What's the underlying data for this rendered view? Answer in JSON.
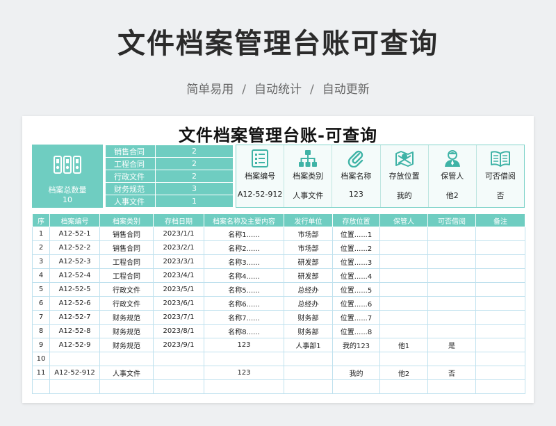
{
  "hero": {
    "title": "文件档案管理台账可查询",
    "features": [
      "简单易用",
      "自动统计",
      "自动更新"
    ],
    "separator": "/"
  },
  "sheet": {
    "title": "文件档案管理台账-可查询",
    "summary": {
      "total_label": "档案总数量",
      "total_value": "10",
      "categories": [
        {
          "name": "销售合同",
          "count": "2"
        },
        {
          "name": "工程合同",
          "count": "2"
        },
        {
          "name": "行政文件",
          "count": "2"
        },
        {
          "name": "财务规范",
          "count": "3"
        },
        {
          "name": "人事文件",
          "count": "1"
        }
      ]
    },
    "query": [
      {
        "icon": "list-number-icon",
        "label": "档案编号",
        "value": "A12-52-912"
      },
      {
        "icon": "hierarchy-icon",
        "label": "档案类别",
        "value": "人事文件"
      },
      {
        "icon": "paperclip-icon",
        "label": "档案名称",
        "value": "123"
      },
      {
        "icon": "map-location-icon",
        "label": "存放位置",
        "value": "我的"
      },
      {
        "icon": "person-icon",
        "label": "保管人",
        "value": "他2"
      },
      {
        "icon": "open-book-icon",
        "label": "可否借阅",
        "value": "否"
      }
    ],
    "columns": [
      "序",
      "档案编号",
      "档案类别",
      "存档日期",
      "档案名称及主要内容",
      "发行单位",
      "存放位置",
      "保管人",
      "可否借阅",
      "备注"
    ],
    "rows": [
      [
        "1",
        "A12-52-1",
        "销售合同",
        "2023/1/1",
        "名称1......",
        "市场部",
        "位置......1",
        "",
        "",
        ""
      ],
      [
        "2",
        "A12-52-2",
        "销售合同",
        "2023/2/1",
        "名称2......",
        "市场部",
        "位置......2",
        "",
        "",
        ""
      ],
      [
        "3",
        "A12-52-3",
        "工程合同",
        "2023/3/1",
        "名称3......",
        "研发部",
        "位置......3",
        "",
        "",
        ""
      ],
      [
        "4",
        "A12-52-4",
        "工程合同",
        "2023/4/1",
        "名称4......",
        "研发部",
        "位置......4",
        "",
        "",
        ""
      ],
      [
        "5",
        "A12-52-5",
        "行政文件",
        "2023/5/1",
        "名称5......",
        "总经办",
        "位置......5",
        "",
        "",
        ""
      ],
      [
        "6",
        "A12-52-6",
        "行政文件",
        "2023/6/1",
        "名称6......",
        "总经办",
        "位置......6",
        "",
        "",
        ""
      ],
      [
        "7",
        "A12-52-7",
        "财务规范",
        "2023/7/1",
        "名称7......",
        "财务部",
        "位置......7",
        "",
        "",
        ""
      ],
      [
        "8",
        "A12-52-8",
        "财务规范",
        "2023/8/1",
        "名称8......",
        "财务部",
        "位置......8",
        "",
        "",
        ""
      ],
      [
        "9",
        "A12-52-9",
        "财务规范",
        "2023/9/1",
        "123",
        "人事部1",
        "我的123",
        "他1",
        "是",
        ""
      ],
      [
        "10",
        "",
        "",
        "",
        "",
        "",
        "",
        "",
        "",
        ""
      ],
      [
        "11",
        "A12-52-912",
        "人事文件",
        "",
        "123",
        "",
        "我的",
        "他2",
        "否",
        ""
      ],
      [
        "",
        "",
        "",
        "",
        "",
        "",
        "",
        "",
        "",
        ""
      ]
    ]
  },
  "colors": {
    "accent": "#6fcdc1",
    "grid": "#bfe1ee",
    "icon": "#3fb3a6"
  }
}
